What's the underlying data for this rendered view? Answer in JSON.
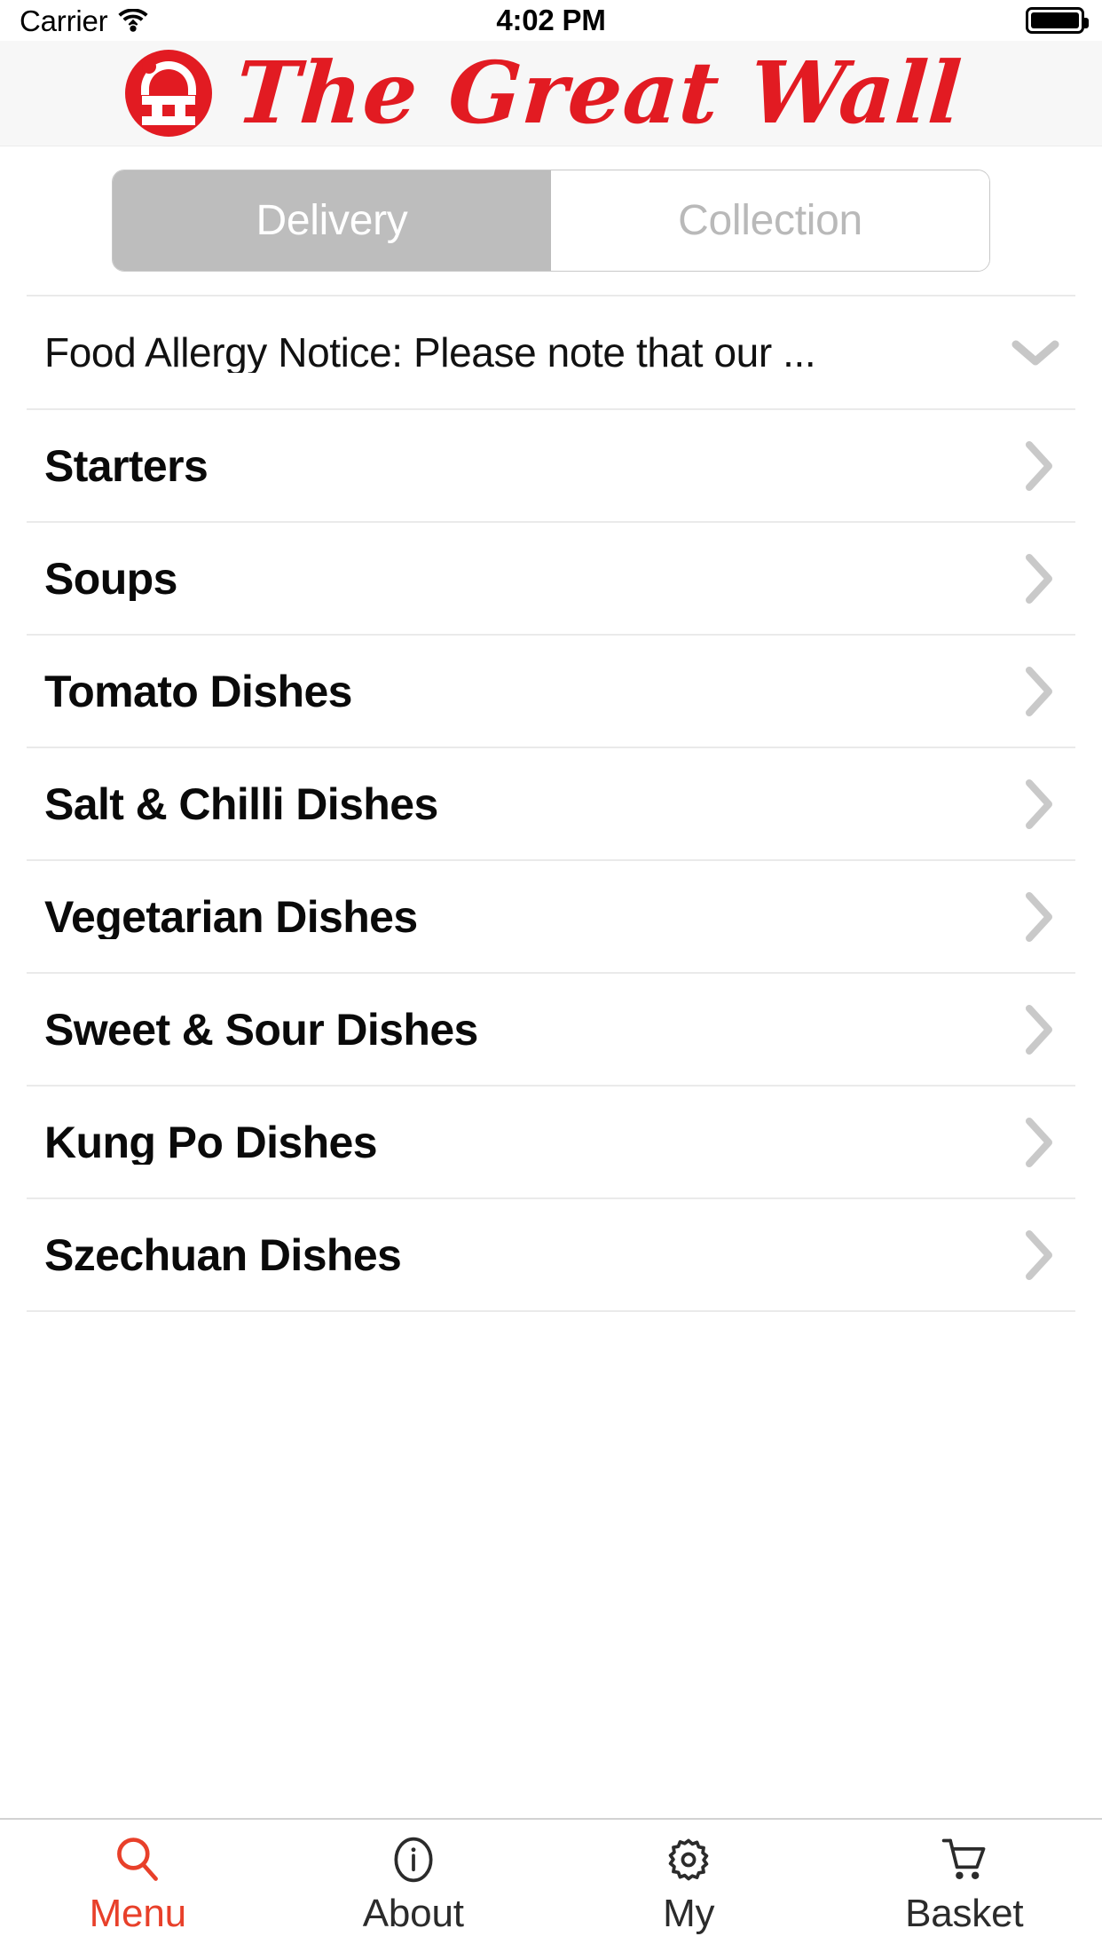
{
  "status_bar": {
    "carrier": "Carrier",
    "time": "4:02 PM",
    "wifi_icon": "wifi-icon",
    "battery_icon": "battery-full-icon"
  },
  "header": {
    "brand_name": "The Great Wall",
    "logo_icon": "great-wall-logo-icon",
    "brand_color": "#e21b22",
    "background": "#f7f7f7"
  },
  "segmented_control": {
    "selected": "Delivery",
    "options": [
      {
        "label": "Delivery",
        "selected": true
      },
      {
        "label": "Collection",
        "selected": false
      }
    ],
    "selected_bg": "#bdbdbd",
    "selected_text": "#ffffff",
    "unselected_text": "#b9b9b9"
  },
  "notice": {
    "text": "Food Allergy Notice: Please note that our ...",
    "expand_icon": "chevron-down-icon"
  },
  "menu_categories": [
    {
      "label": "Starters",
      "chevron": "chevron-right-icon"
    },
    {
      "label": "Soups",
      "chevron": "chevron-right-icon"
    },
    {
      "label": "Tomato Dishes",
      "chevron": "chevron-right-icon"
    },
    {
      "label": "Salt & Chilli Dishes",
      "chevron": "chevron-right-icon"
    },
    {
      "label": "Vegetarian Dishes",
      "chevron": "chevron-right-icon"
    },
    {
      "label": "Sweet & Sour Dishes",
      "chevron": "chevron-right-icon"
    },
    {
      "label": "Kung Po Dishes",
      "chevron": "chevron-right-icon"
    },
    {
      "label": "Szechuan Dishes",
      "chevron": "chevron-right-icon"
    }
  ],
  "tab_bar": {
    "active": "Menu",
    "active_color": "#e8402a",
    "inactive_color": "#2b2b2b",
    "tabs": [
      {
        "label": "Menu",
        "icon": "search-icon",
        "active": true
      },
      {
        "label": "About",
        "icon": "info-circle-icon",
        "active": false
      },
      {
        "label": "My",
        "icon": "gear-icon",
        "active": false
      },
      {
        "label": "Basket",
        "icon": "shopping-cart-icon",
        "active": false
      }
    ]
  }
}
